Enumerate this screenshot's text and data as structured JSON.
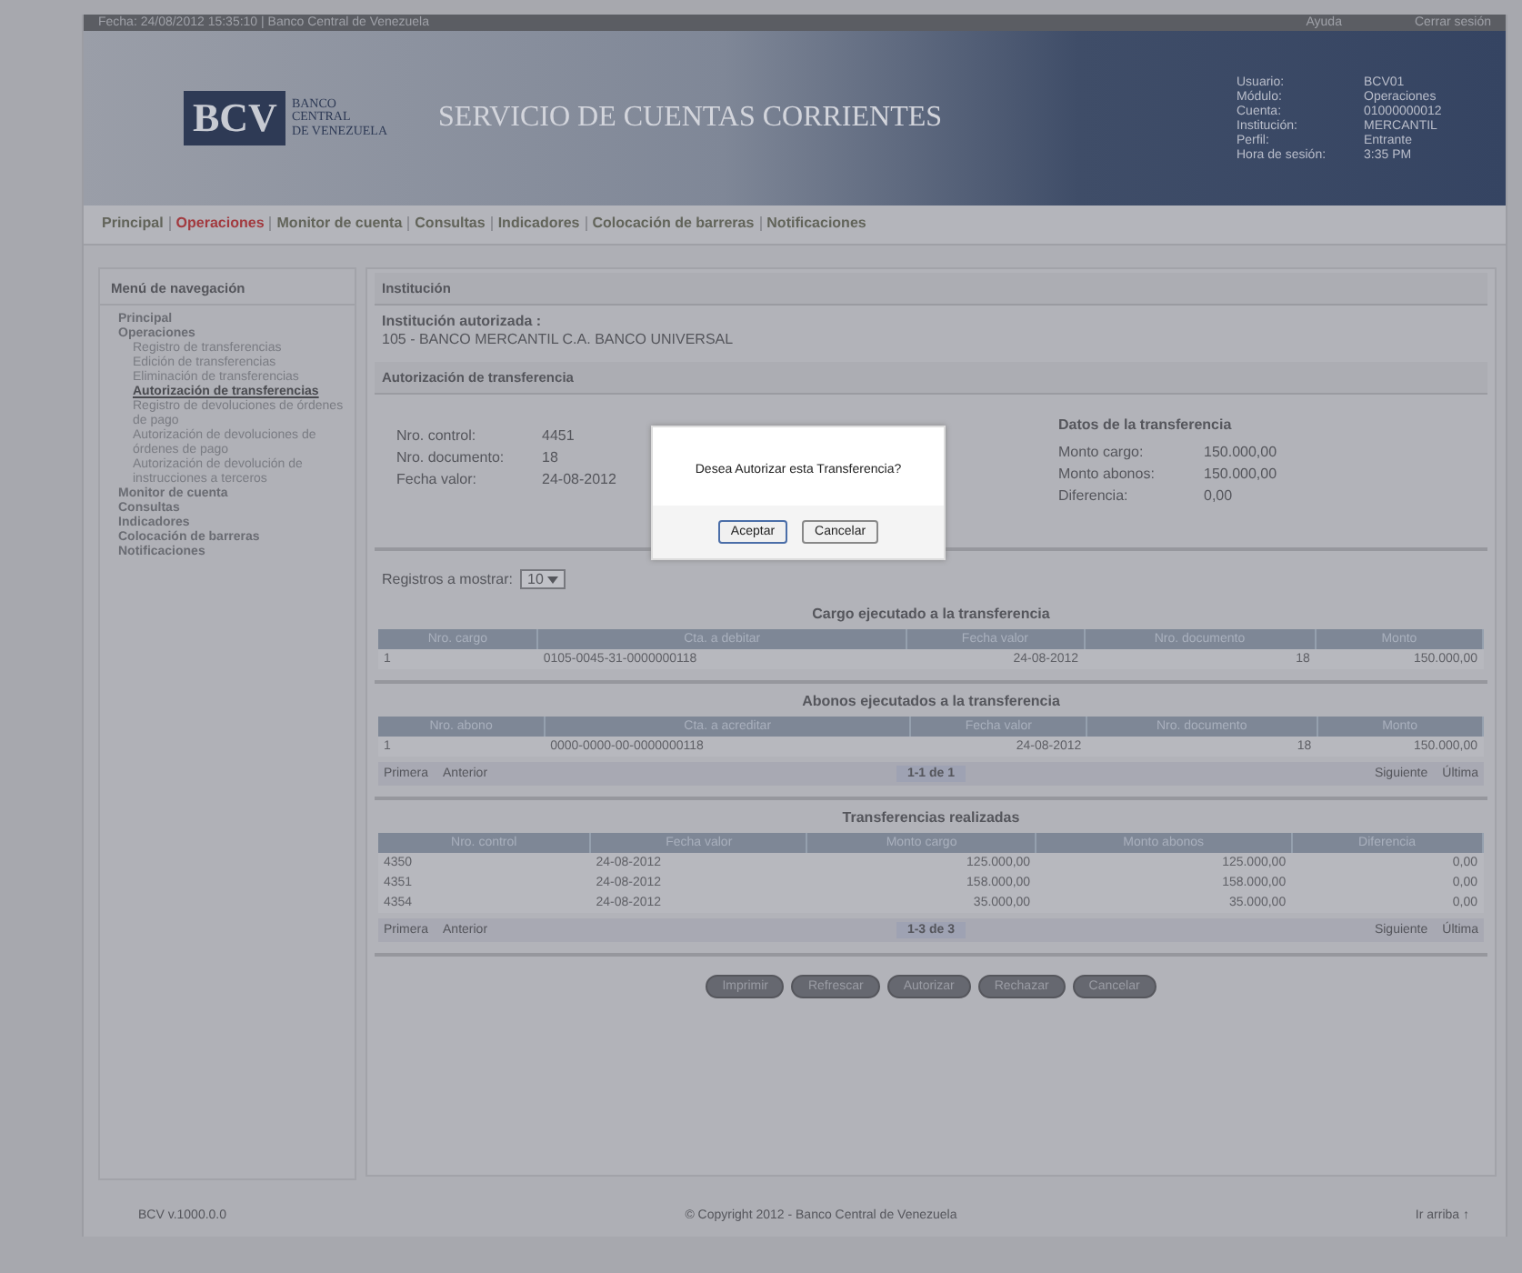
{
  "top_bar": {
    "text": "Fecha: 24/08/2012 15:35:10 | Banco Central de Venezuela",
    "links": [
      "Ayuda",
      "Cerrar sesión"
    ]
  },
  "header": {
    "logo_mark": "BCV",
    "logo_lines": [
      "BANCO",
      "CENTRAL",
      "DE VENEZUELA"
    ],
    "title": "SERVICIO DE CUENTAS CORRIENTES",
    "session": [
      {
        "label": "Usuario:",
        "value": "BCV01"
      },
      {
        "label": "Módulo:",
        "value": "Operaciones"
      },
      {
        "label": "Cuenta:",
        "value": "01000000012"
      },
      {
        "label": "Institución:",
        "value": "MERCANTIL"
      },
      {
        "label": "Perfil:",
        "value": "Entrante"
      },
      {
        "label": "Hora de sesión:",
        "value": "3:35 PM"
      }
    ]
  },
  "nav": [
    {
      "label": "Principal",
      "selected": false
    },
    {
      "label": "Operaciones",
      "selected": true
    },
    {
      "label": "Monitor de cuenta",
      "selected": false
    },
    {
      "label": "Consultas",
      "selected": false
    },
    {
      "label": "Indicadores",
      "selected": false
    },
    {
      "label": "Colocación de barreras",
      "selected": false
    },
    {
      "label": "Notificaciones",
      "selected": false
    }
  ],
  "sidebar": {
    "title": "Menú de navegación",
    "items": [
      {
        "label": "Principal",
        "selected": false
      },
      {
        "label": "Operaciones",
        "selected": false,
        "children": [
          {
            "label": "Registro de transferencias",
            "selected": false
          },
          {
            "label": "Edición de transferencias",
            "selected": false
          },
          {
            "label": "Eliminación de transferencias",
            "selected": false
          },
          {
            "label": "Autorización de transferencias",
            "selected": true
          },
          {
            "label": "Registro de devoluciones de órdenes de pago",
            "selected": false
          },
          {
            "label": "Autorización de devoluciones de órdenes de pago",
            "selected": false
          },
          {
            "label": "Autorización de devolución de instrucciones a terceros",
            "selected": false
          }
        ]
      },
      {
        "label": "Monitor de cuenta",
        "selected": false
      },
      {
        "label": "Consultas",
        "selected": false
      },
      {
        "label": "Indicadores",
        "selected": false
      },
      {
        "label": "Colocación de barreras",
        "selected": false
      },
      {
        "label": "Notificaciones",
        "selected": false
      }
    ]
  },
  "institution": {
    "heading": "Institución",
    "label": "Institución autorizada :",
    "value": "105 - BANCO MERCANTIL C.A. BANCO UNIVERSAL"
  },
  "authorization": {
    "heading": "Autorización de transferencia",
    "right_heading": "Datos de la transferencia",
    "left": [
      {
        "label": "Nro. control:",
        "value": "4451"
      },
      {
        "label": "Nro. documento:",
        "value": "18"
      },
      {
        "label": "Fecha valor:",
        "value": "24-08-2012"
      }
    ],
    "right": [
      {
        "label": "Monto cargo:",
        "value": "150.000,00"
      },
      {
        "label": "Monto abonos:",
        "value": "150.000,00"
      },
      {
        "label": "Diferencia:",
        "value": "0,00"
      }
    ]
  },
  "page_size": {
    "label": "Registros a mostrar:",
    "value": "10"
  },
  "tables": [
    {
      "title": "Cargo ejecutado a la transferencia",
      "columns": [
        "Nro. cargo",
        "Cta. a debitar",
        "Fecha valor",
        "Nro. documento",
        "Monto"
      ],
      "rows": [
        [
          "1",
          "0105-0045-31-0000000118",
          "24-08-2012",
          "18",
          "150.000,00"
        ]
      ]
    },
    {
      "title": "Abonos ejecutados a la transferencia",
      "columns": [
        "Nro. abono",
        "Cta. a acreditar",
        "Fecha valor",
        "Nro. documento",
        "Monto"
      ],
      "rows": [
        [
          "1",
          "0000-0000-00-0000000118",
          "24-08-2012",
          "18",
          "150.000,00"
        ]
      ],
      "pager": {
        "range": "1-1 de 1",
        "left": [
          "Primera",
          "Anterior"
        ],
        "right": [
          "Siguiente",
          "Última"
        ]
      }
    },
    {
      "title": "Transferencias realizadas",
      "columns": [
        "Nro. control",
        "Fecha valor",
        "Monto cargo",
        "Monto abonos",
        "Diferencia"
      ],
      "rows": [
        [
          "4350",
          "24-08-2012",
          "125.000,00",
          "125.000,00",
          "0,00"
        ],
        [
          "4351",
          "24-08-2012",
          "158.000,00",
          "158.000,00",
          "0,00"
        ],
        [
          "4354",
          "24-08-2012",
          "35.000,00",
          "35.000,00",
          "0,00"
        ]
      ],
      "pager": {
        "range": "1-3 de 3",
        "left": [
          "Primera",
          "Anterior"
        ],
        "right": [
          "Siguiente",
          "Última"
        ]
      }
    }
  ],
  "actions": [
    "Imprimir",
    "Refrescar",
    "Autorizar",
    "Rechazar",
    "Cancelar"
  ],
  "footer": {
    "version": "BCV v.1000.0.0",
    "copyright": "© Copyright 2012 - Banco Central de Venezuela",
    "top_link": "Ir arriba ↑"
  },
  "dialog": {
    "message": "Desea Autorizar esta Transferencia?",
    "buttons": [
      "Aceptar",
      "Cancelar"
    ]
  }
}
